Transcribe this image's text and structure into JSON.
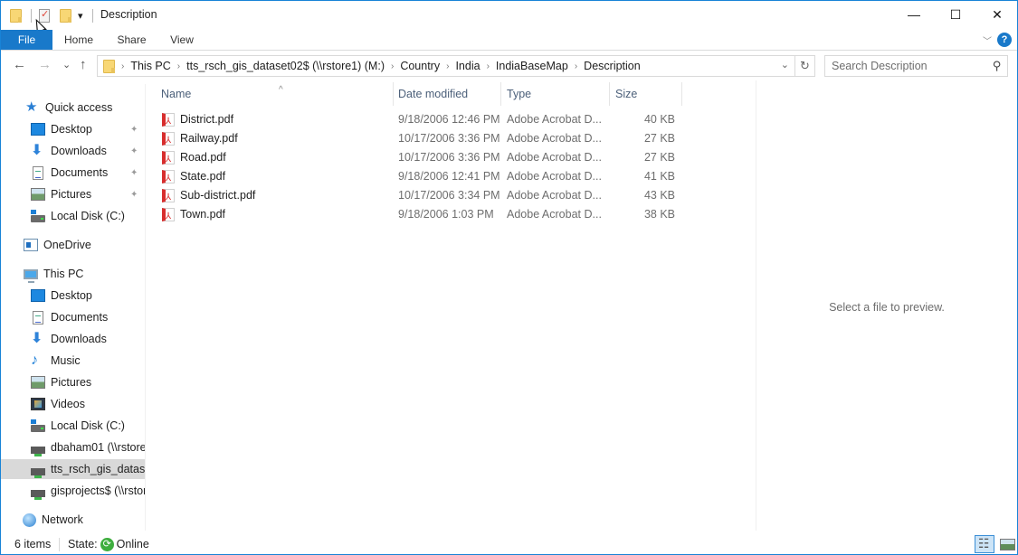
{
  "window": {
    "title": "Description",
    "controls": {
      "minimize": "—",
      "maximize": "☐",
      "close": "✕"
    }
  },
  "quick_access_toolbar": {
    "icons": [
      "folder-icon",
      "properties-icon",
      "new-folder-icon",
      "customize-dropdown-icon"
    ],
    "dropdown_glyph": "▾"
  },
  "ribbon": {
    "tabs": [
      {
        "label": "File",
        "active": true
      },
      {
        "label": "Home"
      },
      {
        "label": "Share"
      },
      {
        "label": "View"
      }
    ],
    "expand_glyph": "﹀",
    "help_glyph": "?"
  },
  "navigation": {
    "back_glyph": "←",
    "forward_glyph": "→",
    "recent_glyph": "⌄",
    "up_glyph": "↑",
    "breadcrumb": [
      "This PC",
      "tts_rsch_gis_dataset02$ (\\\\rstore1) (M:)",
      "Country",
      "India",
      "IndiaBaseMap",
      "Description"
    ],
    "breadcrumb_separator": "›",
    "dropdown_glyph": "⌄",
    "refresh_glyph": "↻",
    "search": {
      "placeholder": "Search Description",
      "value": "",
      "icon_glyph": "⚲"
    }
  },
  "sidebar": {
    "items": [
      {
        "label": "Quick access",
        "icon": "star",
        "level": 0,
        "pinned": false
      },
      {
        "label": "Desktop",
        "icon": "desktop",
        "level": 1,
        "pinned": true
      },
      {
        "label": "Downloads",
        "icon": "download",
        "level": 1,
        "pinned": true
      },
      {
        "label": "Documents",
        "icon": "documents",
        "level": 1,
        "pinned": true
      },
      {
        "label": "Pictures",
        "icon": "pictures",
        "level": 1,
        "pinned": true
      },
      {
        "label": "Local Disk (C:)",
        "icon": "disk",
        "level": 1,
        "pinned": false
      },
      {
        "label": "OneDrive",
        "icon": "onedrive",
        "level": 0,
        "pinned": false
      },
      {
        "label": "This PC",
        "icon": "pc",
        "level": 0,
        "pinned": false
      },
      {
        "label": "Desktop",
        "icon": "desktop",
        "level": 1,
        "pinned": false
      },
      {
        "label": "Documents",
        "icon": "documents",
        "level": 1,
        "pinned": false
      },
      {
        "label": "Downloads",
        "icon": "download",
        "level": 1,
        "pinned": false
      },
      {
        "label": "Music",
        "icon": "music",
        "level": 1,
        "pinned": false
      },
      {
        "label": "Pictures",
        "icon": "pictures",
        "level": 1,
        "pinned": false
      },
      {
        "label": "Videos",
        "icon": "videos",
        "level": 1,
        "pinned": false
      },
      {
        "label": "Local Disk (C:)",
        "icon": "disk",
        "level": 1,
        "pinned": false
      },
      {
        "label": "dbaham01 (\\\\rstore",
        "icon": "netdrive",
        "level": 1,
        "pinned": false
      },
      {
        "label": "tts_rsch_gis_dataset",
        "icon": "netdrive",
        "level": 1,
        "pinned": false,
        "selected": true
      },
      {
        "label": "gisprojects$ (\\\\rstor",
        "icon": "netdrive",
        "level": 1,
        "pinned": false
      },
      {
        "label": "Network",
        "icon": "network",
        "level": 0,
        "pinned": false
      }
    ],
    "pin_glyph": "📌"
  },
  "file_list": {
    "columns": [
      "Name",
      "Date modified",
      "Type",
      "Size"
    ],
    "sort_glyph": "^",
    "rows": [
      {
        "name": "District.pdf",
        "date": "9/18/2006 12:46 PM",
        "type": "Adobe Acrobat D...",
        "size": "40 KB"
      },
      {
        "name": "Railway.pdf",
        "date": "10/17/2006 3:36 PM",
        "type": "Adobe Acrobat D...",
        "size": "27 KB"
      },
      {
        "name": "Road.pdf",
        "date": "10/17/2006 3:36 PM",
        "type": "Adobe Acrobat D...",
        "size": "27 KB"
      },
      {
        "name": "State.pdf",
        "date": "9/18/2006 12:41 PM",
        "type": "Adobe Acrobat D...",
        "size": "41 KB"
      },
      {
        "name": "Sub-district.pdf",
        "date": "10/17/2006 3:34 PM",
        "type": "Adobe Acrobat D...",
        "size": "43 KB"
      },
      {
        "name": "Town.pdf",
        "date": "9/18/2006 1:03 PM",
        "type": "Adobe Acrobat D...",
        "size": "38 KB"
      }
    ]
  },
  "preview": {
    "message": "Select a file to preview."
  },
  "status_bar": {
    "item_count": "6 items",
    "state_label": "State:",
    "state_value": "Online",
    "sync_glyph": "⟳"
  },
  "colors": {
    "accent": "#1979ca",
    "window_border": "#1883d7",
    "selected_nav": "#d9d9d9",
    "pdf_red": "#d82e2e"
  }
}
